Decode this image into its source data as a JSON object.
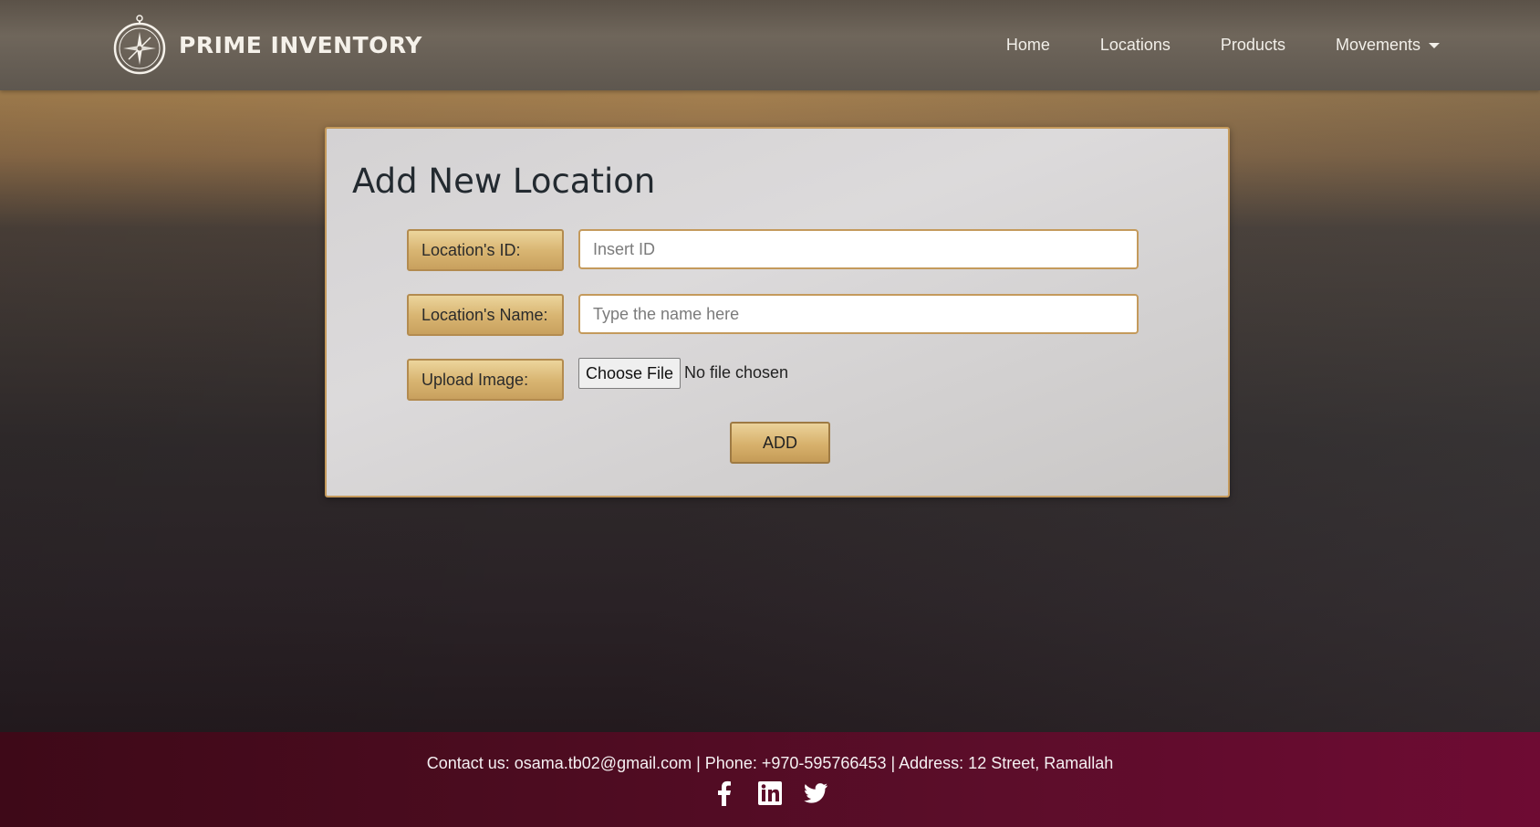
{
  "brand": {
    "name": "PRIME INVENTORY",
    "logo_icon": "compass-icon"
  },
  "nav": {
    "items": [
      {
        "label": "Home"
      },
      {
        "label": "Locations"
      },
      {
        "label": "Products"
      },
      {
        "label": "Movements",
        "has_dropdown": true
      }
    ]
  },
  "form": {
    "title": "Add New Location",
    "id_label": "Location's ID:",
    "id_placeholder": "Insert ID",
    "id_value": "",
    "name_label": "Location's Name:",
    "name_placeholder": "Type the name here",
    "name_value": "",
    "image_label": "Upload Image:",
    "file_button": "Choose File",
    "file_status": "No file chosen",
    "submit_label": "ADD"
  },
  "footer": {
    "contact": "Contact us: osama.tb02@gmail.com | Phone: +970-595766453 | Address: 12 Street, Ramallah",
    "social_icons": [
      "facebook-icon",
      "linkedin-icon",
      "twitter-icon"
    ]
  },
  "colors": {
    "accent_gold": "#d9b673",
    "border_gold": "#c59a5c",
    "footer_crimson": "#5c0d2a",
    "navbar": "#6f665b"
  }
}
